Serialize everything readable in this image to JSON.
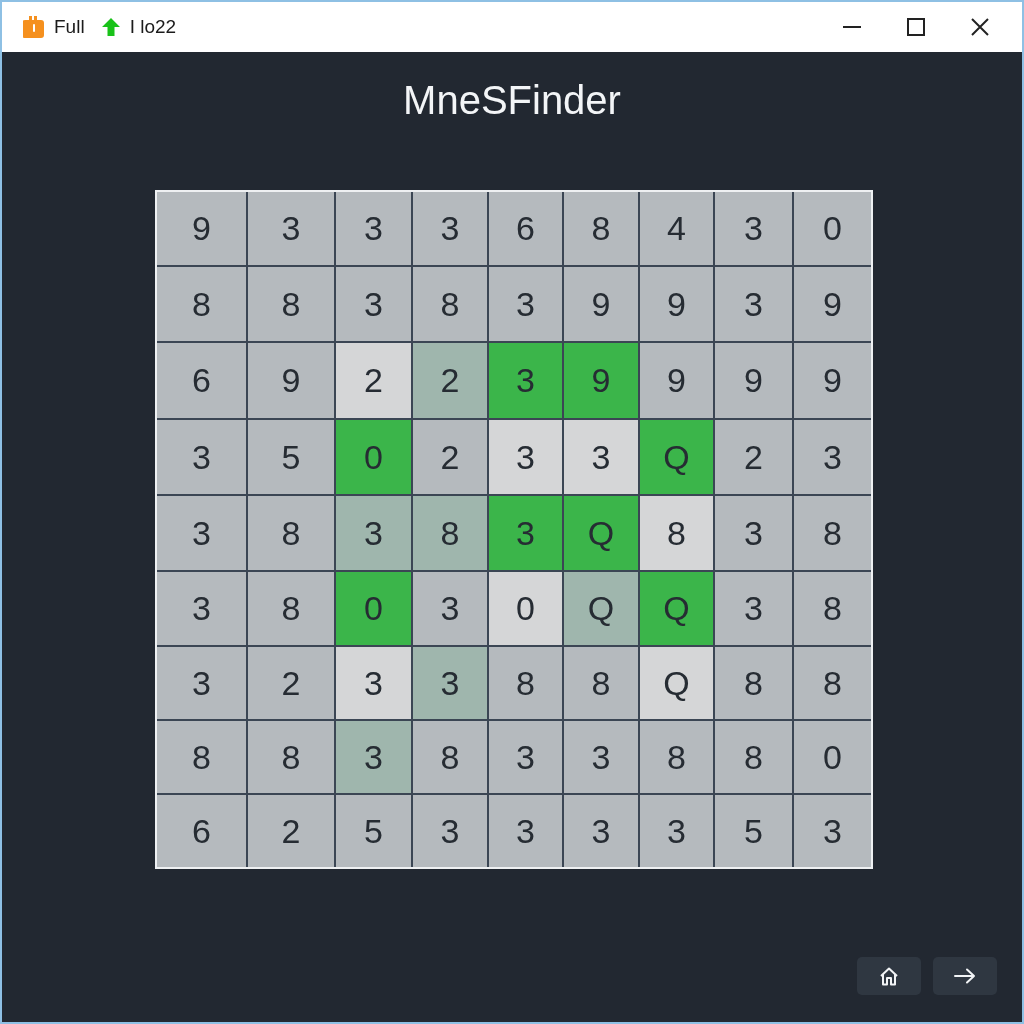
{
  "titlebar": {
    "items": [
      {
        "kind": "app",
        "text": "Full"
      },
      {
        "kind": "upload",
        "text": "I lo22"
      }
    ]
  },
  "app": {
    "title": "MneSFinder"
  },
  "board": {
    "rows": [
      [
        {
          "text": "9",
          "color": "#b5babe"
        },
        {
          "text": "3",
          "color": "#b5babe"
        },
        {
          "text": "3",
          "color": "#b5babe"
        },
        {
          "text": "3",
          "color": "#b5babe"
        },
        {
          "text": "6",
          "color": "#b5babe"
        },
        {
          "text": "8",
          "color": "#b5babe"
        },
        {
          "text": "4",
          "color": "#b5babe"
        },
        {
          "text": "3",
          "color": "#b5babe"
        },
        {
          "text": "0",
          "color": "#b5babe"
        }
      ],
      [
        {
          "text": "8",
          "color": "#b5babe"
        },
        {
          "text": "8",
          "color": "#b5babe"
        },
        {
          "text": "3",
          "color": "#b5babe"
        },
        {
          "text": "8",
          "color": "#b5babe"
        },
        {
          "text": "3",
          "color": "#b5babe"
        },
        {
          "text": "9",
          "color": "#b5babe"
        },
        {
          "text": "9",
          "color": "#b5babe"
        },
        {
          "text": "3",
          "color": "#b5babe"
        },
        {
          "text": "9",
          "color": "#b5babe"
        }
      ],
      [
        {
          "text": "6",
          "color": "#b5babe"
        },
        {
          "text": "9",
          "color": "#b5babe"
        },
        {
          "text": "2",
          "color": "#d5d6d7"
        },
        {
          "text": "2",
          "color": "#9fb6ad"
        },
        {
          "text": "3",
          "color": "#3bb54a"
        },
        {
          "text": "9",
          "color": "#3bb54a"
        },
        {
          "text": "9",
          "color": "#b5babe"
        },
        {
          "text": "9",
          "color": "#b5babe"
        },
        {
          "text": "9",
          "color": "#b5babe"
        }
      ],
      [
        {
          "text": "3",
          "color": "#b5babe"
        },
        {
          "text": "5",
          "color": "#b5babe"
        },
        {
          "text": "0",
          "color": "#3bb54a"
        },
        {
          "text": "2",
          "color": "#b5babe"
        },
        {
          "text": "3",
          "color": "#d5d6d7"
        },
        {
          "text": "3",
          "color": "#d5d6d7"
        },
        {
          "text": "Q",
          "color": "#3bb54a"
        },
        {
          "text": "2",
          "color": "#b5babe"
        },
        {
          "text": "3",
          "color": "#b5babe"
        }
      ],
      [
        {
          "text": "3",
          "color": "#b5babe"
        },
        {
          "text": "8",
          "color": "#b5babe"
        },
        {
          "text": "3",
          "color": "#9fb6ad"
        },
        {
          "text": "8",
          "color": "#9fb6ad"
        },
        {
          "text": "3",
          "color": "#3bb54a"
        },
        {
          "text": "Q",
          "color": "#3bb54a"
        },
        {
          "text": "8",
          "color": "#d5d6d7"
        },
        {
          "text": "3",
          "color": "#b5babe"
        },
        {
          "text": "8",
          "color": "#b5babe"
        }
      ],
      [
        {
          "text": "3",
          "color": "#b5babe"
        },
        {
          "text": "8",
          "color": "#b5babe"
        },
        {
          "text": "0",
          "color": "#3bb54a"
        },
        {
          "text": "3",
          "color": "#b5babe"
        },
        {
          "text": "0",
          "color": "#d5d6d7"
        },
        {
          "text": "Q",
          "color": "#9fb6ad"
        },
        {
          "text": "Q",
          "color": "#3bb54a"
        },
        {
          "text": "3",
          "color": "#b5babe"
        },
        {
          "text": "8",
          "color": "#b5babe"
        }
      ],
      [
        {
          "text": "3",
          "color": "#b5babe"
        },
        {
          "text": "2",
          "color": "#b5babe"
        },
        {
          "text": "3",
          "color": "#d5d6d7"
        },
        {
          "text": "3",
          "color": "#9fb6ad"
        },
        {
          "text": "8",
          "color": "#b5babe"
        },
        {
          "text": "8",
          "color": "#b5babe"
        },
        {
          "text": "Q",
          "color": "#d5d6d7"
        },
        {
          "text": "8",
          "color": "#b5babe"
        },
        {
          "text": "8",
          "color": "#b5babe"
        }
      ],
      [
        {
          "text": "8",
          "color": "#b5babe"
        },
        {
          "text": "8",
          "color": "#b5babe"
        },
        {
          "text": "3",
          "color": "#9fb6ad"
        },
        {
          "text": "8",
          "color": "#b5babe"
        },
        {
          "text": "3",
          "color": "#b5babe"
        },
        {
          "text": "3",
          "color": "#b5babe"
        },
        {
          "text": "8",
          "color": "#b5babe"
        },
        {
          "text": "8",
          "color": "#b5babe"
        },
        {
          "text": "0",
          "color": "#b5babe"
        }
      ],
      [
        {
          "text": "6",
          "color": "#b5babe"
        },
        {
          "text": "2",
          "color": "#b5babe"
        },
        {
          "text": "5",
          "color": "#b5babe"
        },
        {
          "text": "3",
          "color": "#b5babe"
        },
        {
          "text": "3",
          "color": "#b5babe"
        },
        {
          "text": "3",
          "color": "#b5babe"
        },
        {
          "text": "3",
          "color": "#b5babe"
        },
        {
          "text": "5",
          "color": "#b5babe"
        },
        {
          "text": "3",
          "color": "#b5babe"
        }
      ]
    ]
  }
}
